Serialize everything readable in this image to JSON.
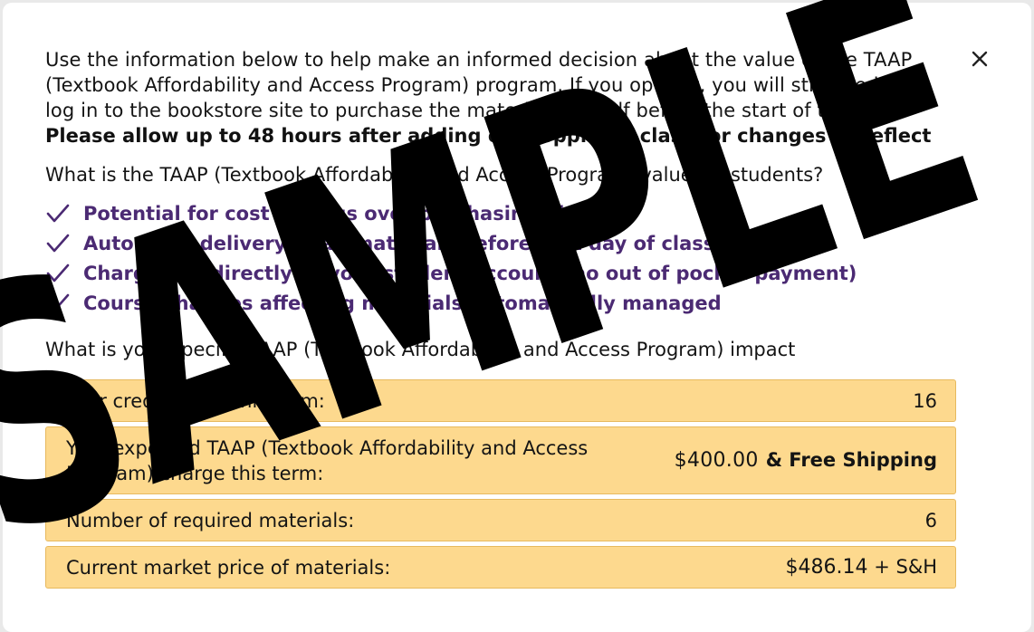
{
  "dialog": {
    "intro_lines": [
      "Use the information below to help make an informed decision about the value of the TAAP",
      "(Textbook Affordability and Access Program) program. If you opt-out, you will still need to",
      "log in to the bookstore site to purchase the material yourself before the start of the term."
    ],
    "bold_notice": "Please allow up to 48 hours after adding or dropping a class for changes to reflect",
    "question": "What is the TAAP (Textbook Affordability and Access Program) value for students?",
    "benefits": [
      "Potential for cost savings over purchasing directly",
      "Automatic delivery of all materials before first day of class",
      "Charges go directly to your student account (no out of pocket payment)",
      "Course changes affecting materials automatically managed"
    ],
    "impact_heading": "What is your specific TAAP (Textbook Affordability and Access Program) impact",
    "rows": {
      "credit_hours": {
        "label": "Your credit hours this term:",
        "value": "16"
      },
      "expected_charge": {
        "label_line1": "Your expected TAAP (Textbook Affordability and Access",
        "label_line2": "Program) charge this term:",
        "amount": "$400.00",
        "extra": "& Free Shipping"
      },
      "required_materials": {
        "label": "Number of required materials:",
        "value": "6"
      },
      "market_price": {
        "label": "Current market price of materials:",
        "amount": "$486.14",
        "extra": "+ S&H"
      }
    },
    "watermark": "SAMPLE",
    "colors": {
      "accent_purple": "#4b2a73",
      "row_background": "#fdd98e",
      "row_border": "#e7b95e"
    },
    "icons": {
      "close": "close-icon",
      "benefit": "checkmark-icon"
    }
  }
}
